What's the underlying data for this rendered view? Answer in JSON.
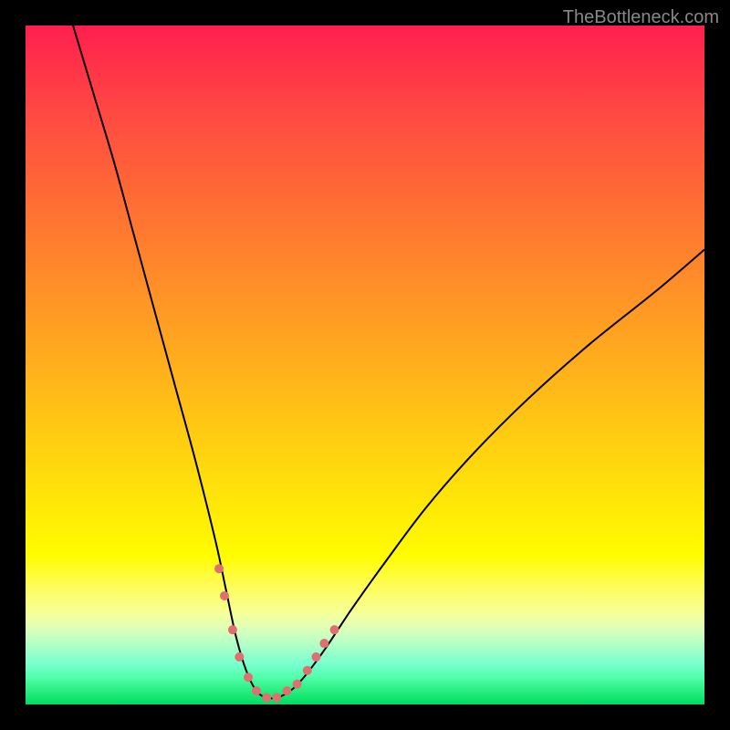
{
  "watermark": "TheBottleneck.com",
  "chart_data": {
    "type": "line",
    "title": "",
    "xlabel": "",
    "ylabel": "",
    "xlim": [
      0,
      100
    ],
    "ylim": [
      0,
      100
    ],
    "gradient": {
      "description": "vertical gradient from red (top, high bottleneck) through yellow to green (bottom, no bottleneck)",
      "stops": [
        {
          "pos": 0,
          "color": "#ff1e50"
        },
        {
          "pos": 50,
          "color": "#ffd010"
        },
        {
          "pos": 78,
          "color": "#fffc00"
        },
        {
          "pos": 100,
          "color": "#00dd60"
        }
      ]
    },
    "series": [
      {
        "name": "bottleneck-curve",
        "type": "line",
        "color": "#000000",
        "x": [
          7,
          10,
          13,
          16,
          19,
          22,
          25,
          28,
          29.5,
          31,
          32.5,
          34,
          35.5,
          37,
          39,
          41,
          44,
          48,
          53,
          59,
          66,
          74,
          83,
          93,
          100
        ],
        "y": [
          100,
          90,
          80,
          69,
          58,
          47,
          36,
          24,
          17,
          10,
          5,
          2,
          1,
          1,
          2,
          4,
          8,
          14,
          21,
          29,
          37,
          45,
          53,
          61,
          67
        ]
      },
      {
        "name": "scatter-points",
        "type": "scatter",
        "color": "#e07070",
        "marker_size": 10,
        "x": [
          28.5,
          29.3,
          30.5,
          31.5,
          32.8,
          34.0,
          35.5,
          37.0,
          38.5,
          40.0,
          41.5,
          42.8,
          44.0,
          45.5
        ],
        "y": [
          20,
          16,
          11,
          7,
          4,
          2,
          1,
          1,
          2,
          3,
          5,
          7,
          9,
          11
        ]
      }
    ]
  }
}
